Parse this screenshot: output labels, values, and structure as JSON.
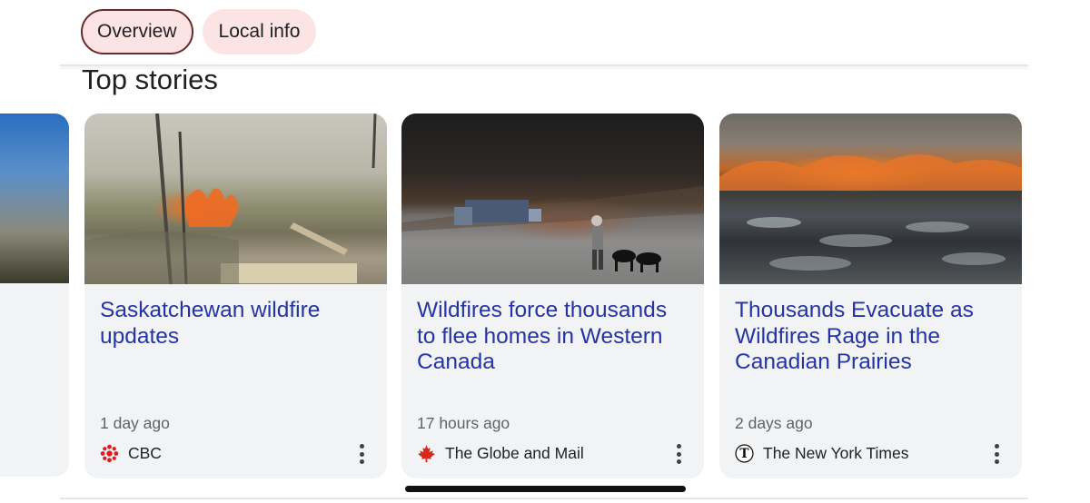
{
  "tabs": [
    {
      "label": "Overview",
      "active": true
    },
    {
      "label": "Local info",
      "active": false
    }
  ],
  "section": {
    "title": "Top stories"
  },
  "stories": [
    {
      "title": "Saskatchewan wildfire updates",
      "time": "1 day ago",
      "source": "CBC",
      "source_icon": "cbc-logo-icon",
      "source_color": "#e01a22",
      "image": "forest-fire-photo"
    },
    {
      "title": "Wildfires force thousands to flee homes in Western Canada",
      "time": "17 hours ago",
      "source": "The Globe and Mail",
      "source_icon": "maple-leaf-icon",
      "source_color": "#d52b1e",
      "image": "evacuation-road-photo"
    },
    {
      "title": "Thousands Evacuate as Wildfires Rage in the Canadian Prairies",
      "time": "2 days ago",
      "source": "The New York Times",
      "source_icon": "nyt-logo-icon",
      "source_color": "#111111",
      "image": "prairie-fire-aerial-photo"
    }
  ],
  "colors": {
    "chip_background": "#fde4e4",
    "chip_active_border": "#6a2a2a",
    "headline": "#2534a4",
    "meta_text": "#5f6368",
    "card_background": "#f2f3f5"
  }
}
